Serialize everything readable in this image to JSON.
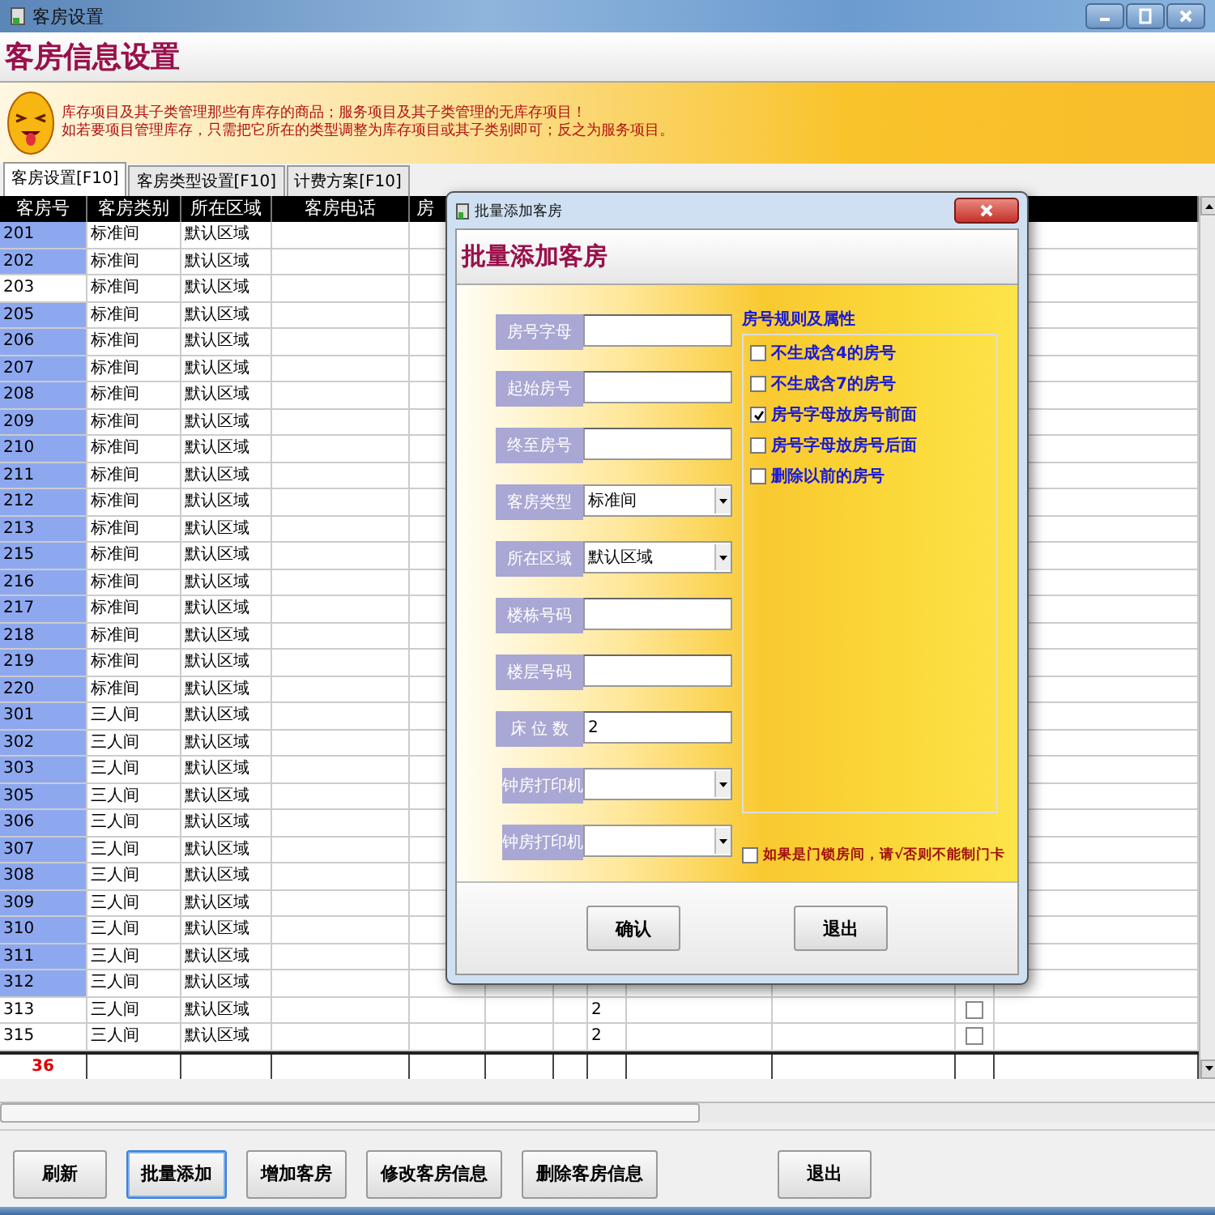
{
  "window": {
    "title": "客房设置"
  },
  "header": {
    "title": "客房信息设置"
  },
  "banner": {
    "lines": [
      "库存项目及其子类管理那些有库存的商品；服务项目及其子类管理的无库存项目！",
      "如若要项目管理库存，只需把它所在的类型调整为库存项目或其子类别即可；反之为服务项目。"
    ]
  },
  "tabs": [
    {
      "label": "客房设置[F10]",
      "selected": true
    },
    {
      "label": "客房类型设置[F10]",
      "selected": false
    },
    {
      "label": "计费方案[F10]",
      "selected": false
    }
  ],
  "table": {
    "columns": [
      "客房号",
      "客房类别",
      "所在区域",
      "客房电话",
      "房"
    ],
    "rows": [
      {
        "room": "201",
        "type": "标准间",
        "area": "默认区域",
        "selected": true
      },
      {
        "room": "202",
        "type": "标准间",
        "area": "默认区域",
        "selected": true
      },
      {
        "room": "203",
        "type": "标准间",
        "area": "默认区域",
        "selected": false
      },
      {
        "room": "205",
        "type": "标准间",
        "area": "默认区域",
        "selected": true
      },
      {
        "room": "206",
        "type": "标准间",
        "area": "默认区域",
        "selected": true
      },
      {
        "room": "207",
        "type": "标准间",
        "area": "默认区域",
        "selected": true
      },
      {
        "room": "208",
        "type": "标准间",
        "area": "默认区域",
        "selected": true
      },
      {
        "room": "209",
        "type": "标准间",
        "area": "默认区域",
        "selected": true
      },
      {
        "room": "210",
        "type": "标准间",
        "area": "默认区域",
        "selected": true
      },
      {
        "room": "211",
        "type": "标准间",
        "area": "默认区域",
        "selected": true
      },
      {
        "room": "212",
        "type": "标准间",
        "area": "默认区域",
        "selected": true
      },
      {
        "room": "213",
        "type": "标准间",
        "area": "默认区域",
        "selected": true
      },
      {
        "room": "215",
        "type": "标准间",
        "area": "默认区域",
        "selected": true
      },
      {
        "room": "216",
        "type": "标准间",
        "area": "默认区域",
        "selected": true
      },
      {
        "room": "217",
        "type": "标准间",
        "area": "默认区域",
        "selected": true
      },
      {
        "room": "218",
        "type": "标准间",
        "area": "默认区域",
        "selected": true
      },
      {
        "room": "219",
        "type": "标准间",
        "area": "默认区域",
        "selected": true
      },
      {
        "room": "220",
        "type": "标准间",
        "area": "默认区域",
        "selected": true
      },
      {
        "room": "301",
        "type": "三人间",
        "area": "默认区域",
        "selected": true
      },
      {
        "room": "302",
        "type": "三人间",
        "area": "默认区域",
        "selected": true
      },
      {
        "room": "303",
        "type": "三人间",
        "area": "默认区域",
        "selected": true
      },
      {
        "room": "305",
        "type": "三人间",
        "area": "默认区域",
        "selected": true
      },
      {
        "room": "306",
        "type": "三人间",
        "area": "默认区域",
        "selected": true
      },
      {
        "room": "307",
        "type": "三人间",
        "area": "默认区域",
        "selected": true
      },
      {
        "room": "308",
        "type": "三人间",
        "area": "默认区域",
        "selected": true
      },
      {
        "room": "309",
        "type": "三人间",
        "area": "默认区域",
        "selected": true
      },
      {
        "room": "310",
        "type": "三人间",
        "area": "默认区域",
        "selected": true
      },
      {
        "room": "311",
        "type": "三人间",
        "area": "默认区域",
        "selected": true
      },
      {
        "room": "312",
        "type": "三人间",
        "area": "默认区域",
        "selected": true
      },
      {
        "room": "313",
        "type": "三人间",
        "area": "默认区域",
        "selected": false,
        "beds": "2",
        "lock": false
      },
      {
        "room": "315",
        "type": "三人间",
        "area": "默认区域",
        "selected": false,
        "beds": "2",
        "lock": false
      }
    ],
    "footer": {
      "count": "36"
    }
  },
  "buttons": [
    {
      "label": "刷新",
      "focused": false
    },
    {
      "label": "批量添加",
      "focused": true
    },
    {
      "label": "增加客房",
      "focused": false
    },
    {
      "label": "修改客房信息",
      "focused": false
    },
    {
      "label": "删除客房信息",
      "focused": false
    },
    {
      "label": "退出",
      "focused": false
    }
  ],
  "dialog": {
    "title": "批量添加客房",
    "header": "批量添加客房",
    "fields": [
      {
        "label": "房号字母",
        "kind": "text"
      },
      {
        "label": "起始房号",
        "kind": "text"
      },
      {
        "label": "终至房号",
        "kind": "text"
      },
      {
        "label": "客房类型",
        "kind": "select",
        "value": "标准间"
      },
      {
        "label": "所在区域",
        "kind": "select",
        "value": "默认区域"
      },
      {
        "label": "楼栋号码",
        "kind": "text"
      },
      {
        "label": "楼层号码",
        "kind": "text"
      },
      {
        "label": "床 位 数",
        "kind": "text",
        "value": "2"
      },
      {
        "label": "钟房打印机",
        "kind": "select"
      },
      {
        "label": "钟房打印机",
        "kind": "select"
      }
    ],
    "group": {
      "title": "房号规则及属性",
      "options": [
        {
          "label": "不生成含4的房号",
          "checked": false
        },
        {
          "label": "不生成含7的房号",
          "checked": false
        },
        {
          "label": "房号字母放房号前面",
          "checked": true
        },
        {
          "label": "房号字母放房号后面",
          "checked": false
        },
        {
          "label": "删除以前的房号",
          "checked": false
        }
      ]
    },
    "lock_option": {
      "label": "如果是门锁房间，请√否则不能制门卡",
      "checked": false
    },
    "buttons": [
      "确认",
      "退出"
    ]
  }
}
